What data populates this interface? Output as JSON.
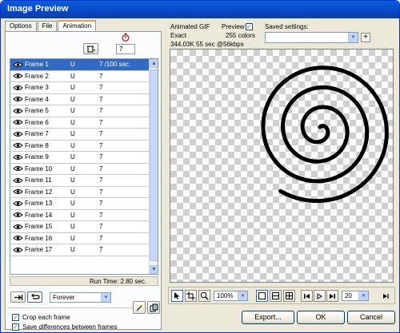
{
  "window": {
    "title": "Image Preview"
  },
  "tabs": [
    {
      "label": "Options"
    },
    {
      "label": "File"
    },
    {
      "label": "Animation"
    }
  ],
  "animation": {
    "delay_value": "7",
    "frames": [
      {
        "name": "Frame 1",
        "mode": "U",
        "delay": "7 /100 sec."
      },
      {
        "name": "Frame 2",
        "mode": "U",
        "delay": "7"
      },
      {
        "name": "Frame 3",
        "mode": "U",
        "delay": "7"
      },
      {
        "name": "Frame 4",
        "mode": "U",
        "delay": "7"
      },
      {
        "name": "Frame 5",
        "mode": "U",
        "delay": "7"
      },
      {
        "name": "Frame 6",
        "mode": "U",
        "delay": "7"
      },
      {
        "name": "Frame 7",
        "mode": "U",
        "delay": "7"
      },
      {
        "name": "Frame 8",
        "mode": "U",
        "delay": "7"
      },
      {
        "name": "Frame 9",
        "mode": "U",
        "delay": "7"
      },
      {
        "name": "Frame 10",
        "mode": "U",
        "delay": "7"
      },
      {
        "name": "Frame 11",
        "mode": "U",
        "delay": "7"
      },
      {
        "name": "Frame 12",
        "mode": "U",
        "delay": "7"
      },
      {
        "name": "Frame 13",
        "mode": "U",
        "delay": "7"
      },
      {
        "name": "Frame 14",
        "mode": "U",
        "delay": "7"
      },
      {
        "name": "Frame 15",
        "mode": "U",
        "delay": "7"
      },
      {
        "name": "Frame 16",
        "mode": "U",
        "delay": "7"
      },
      {
        "name": "Frame 17",
        "mode": "U",
        "delay": "7"
      }
    ],
    "run_time": "Run Time: 2.80 sec.",
    "loop_value": "Forever",
    "crop_label": "Crop each frame",
    "save_diff_label": "Save differences between frames"
  },
  "info": {
    "format": "Animated GIF",
    "quality": "Exact",
    "size": "344.03K  55 sec @56kbps",
    "preview_label": "Preview",
    "colors": "255 colors",
    "saved_settings_label": "Saved settings:"
  },
  "toolbar": {
    "zoom_value": "100%",
    "frame_value": "20"
  },
  "buttons": {
    "export": "Export...",
    "ok": "OK",
    "cancel": "Cancel"
  },
  "colors": {
    "titlebar": "#0846c4",
    "selection": "#316ac5",
    "check": "#21a121"
  }
}
